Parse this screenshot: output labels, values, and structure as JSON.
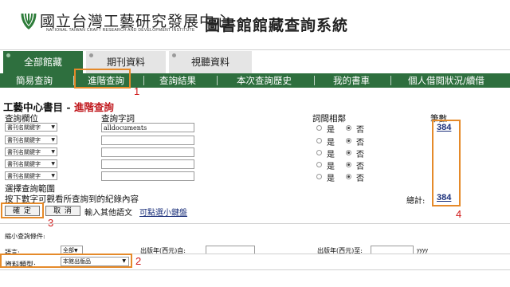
{
  "header": {
    "logo_cn": "國立台灣工藝研究發展中心",
    "logo_en": "NATIONAL TAIWAN CRAFT RESEARCH AND DEVELOPMENT INSTITUTE",
    "system_title": "圖書館館藏查詢系統"
  },
  "top_tabs": [
    {
      "label": "全部館藏",
      "active": true
    },
    {
      "label": "期刊資料",
      "active": false
    },
    {
      "label": "視聽資料",
      "active": false
    }
  ],
  "nav": {
    "items": [
      "簡易查詢",
      "進階查詢",
      "查詢結果",
      "本次查詢歷史",
      "我的書車",
      "個人借閱狀況/續借"
    ]
  },
  "annotations": [
    "1",
    "2",
    "3",
    "4"
  ],
  "colors": {
    "nav_green": "#2e6f3e",
    "highlight_orange": "#e58a2a",
    "annotation_red": "#d01a1a",
    "link_blue": "#1a2f7a"
  },
  "form": {
    "title": "工藝中心書目",
    "title_sep": " - ",
    "title_sub": "進階查詢",
    "col_field": "查詢欄位",
    "col_term": "查詢字詞",
    "col_adjacent": "詞間相鄰",
    "col_count": "筆數",
    "rows": [
      {
        "field": "書刊名關鍵字",
        "term": "alldocuments",
        "yes": "是",
        "no": "否",
        "selected": "no",
        "count": "384"
      },
      {
        "field": "書刊名關鍵字",
        "term": "",
        "yes": "是",
        "no": "否",
        "selected": "no",
        "count": ""
      },
      {
        "field": "書刊名關鍵字",
        "term": "",
        "yes": "是",
        "no": "否",
        "selected": "no",
        "count": ""
      },
      {
        "field": "書刊名關鍵字",
        "term": "",
        "yes": "是",
        "no": "否",
        "selected": "no",
        "count": ""
      },
      {
        "field": "書刊名關鍵字",
        "term": "",
        "yes": "是",
        "no": "否",
        "selected": "no",
        "count": ""
      }
    ],
    "select_range": "選擇查詢範圍",
    "hint": "按下數字可觀看所查詢到的紀錄內容",
    "total_label": "總計:",
    "total_count": "384",
    "confirm_label": "確 定",
    "cancel_label": "取 消",
    "other_lang_label": "輸入其他語文",
    "keyboard_link": "可點選小鍵盤"
  },
  "limits": {
    "title": "縮小查詢條件:",
    "language_label": "語言:",
    "language_value": "全部",
    "year_from_label": "出版年(西元)自:",
    "year_to_label": "出版年(西元)至:",
    "year_unit": "yyyy",
    "type_label": "資料類型:",
    "type_value": "本館出版品"
  }
}
